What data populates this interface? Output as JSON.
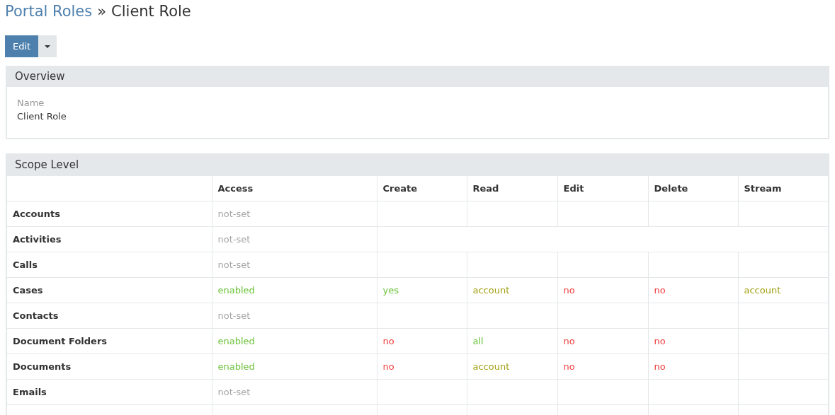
{
  "breadcrumb": {
    "parent": "Portal Roles",
    "separator": "»",
    "current": "Client Role"
  },
  "actions": {
    "edit": "Edit"
  },
  "overview": {
    "title": "Overview",
    "field_label": "Name",
    "field_value": "Client Role"
  },
  "scope": {
    "title": "Scope Level",
    "columns": [
      "Access",
      "Create",
      "Read",
      "Edit",
      "Delete",
      "Stream"
    ],
    "rows": [
      {
        "name": "Accounts",
        "kind": "split",
        "access": {
          "text": "not-set",
          "kind": "unset"
        }
      },
      {
        "name": "Activities",
        "kind": "merged",
        "access": {
          "text": "not-set",
          "kind": "unset"
        }
      },
      {
        "name": "Calls",
        "kind": "split",
        "access": {
          "text": "not-set",
          "kind": "unset"
        }
      },
      {
        "name": "Cases",
        "kind": "split",
        "access": {
          "text": "enabled",
          "kind": "positive"
        },
        "create": {
          "text": "yes",
          "kind": "positive"
        },
        "read": {
          "text": "account",
          "kind": "partial"
        },
        "edit": {
          "text": "no",
          "kind": "negative"
        },
        "delete": {
          "text": "no",
          "kind": "negative"
        },
        "stream": {
          "text": "account",
          "kind": "partial"
        }
      },
      {
        "name": "Contacts",
        "kind": "split",
        "access": {
          "text": "not-set",
          "kind": "unset"
        }
      },
      {
        "name": "Document Folders",
        "kind": "split",
        "access": {
          "text": "enabled",
          "kind": "positive"
        },
        "create": {
          "text": "no",
          "kind": "negative"
        },
        "read": {
          "text": "all",
          "kind": "positive"
        },
        "edit": {
          "text": "no",
          "kind": "negative"
        },
        "delete": {
          "text": "no",
          "kind": "negative"
        }
      },
      {
        "name": "Documents",
        "kind": "split",
        "access": {
          "text": "enabled",
          "kind": "positive"
        },
        "create": {
          "text": "no",
          "kind": "negative"
        },
        "read": {
          "text": "account",
          "kind": "partial"
        },
        "edit": {
          "text": "no",
          "kind": "negative"
        },
        "delete": {
          "text": "no",
          "kind": "negative"
        }
      },
      {
        "name": "Emails",
        "kind": "split",
        "access": {
          "text": "not-set",
          "kind": "unset"
        }
      }
    ]
  }
}
